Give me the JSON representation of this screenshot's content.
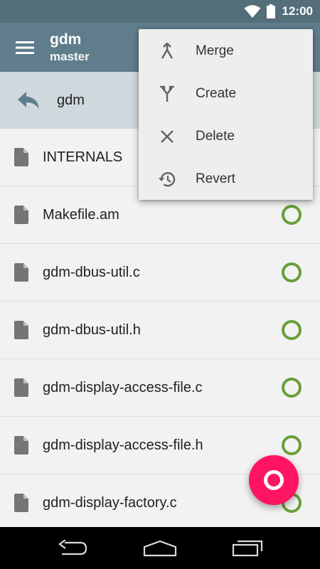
{
  "status_bar": {
    "time": "12:00",
    "icons": [
      "wifi-icon",
      "battery-icon"
    ]
  },
  "app_bar": {
    "menu_icon": "hamburger-menu-icon",
    "title": "gdm",
    "subtitle": "master"
  },
  "up_row": {
    "icon": "back-arrow-icon",
    "label": "gdm"
  },
  "files": [
    {
      "name": "INTERNALS",
      "icon": "file-icon",
      "status": "none"
    },
    {
      "name": "Makefile.am",
      "icon": "file-icon",
      "status": "unchanged"
    },
    {
      "name": "gdm-dbus-util.c",
      "icon": "file-icon",
      "status": "unchanged"
    },
    {
      "name": "gdm-dbus-util.h",
      "icon": "file-icon",
      "status": "unchanged"
    },
    {
      "name": "gdm-display-access-file.c",
      "icon": "file-icon",
      "status": "unchanged"
    },
    {
      "name": "gdm-display-access-file.h",
      "icon": "file-icon",
      "status": "unchanged"
    },
    {
      "name": "gdm-display-factory.c",
      "icon": "file-icon",
      "status": "unchanged"
    }
  ],
  "popup_menu": {
    "items": [
      {
        "label": "Merge",
        "icon": "merge-icon"
      },
      {
        "label": "Create",
        "icon": "fork-icon"
      },
      {
        "label": "Delete",
        "icon": "close-icon"
      },
      {
        "label": "Revert",
        "icon": "history-icon"
      }
    ]
  },
  "fab": {
    "icon": "ring-icon"
  },
  "nav_bar": {
    "icons": [
      "back-icon",
      "home-icon",
      "recents-icon"
    ]
  },
  "colors": {
    "status_bar": "#546e7a",
    "app_bar": "#607d8b",
    "up_row": "#cfd8dc",
    "status_ring": "#689f38",
    "fab": "#ff1461"
  }
}
